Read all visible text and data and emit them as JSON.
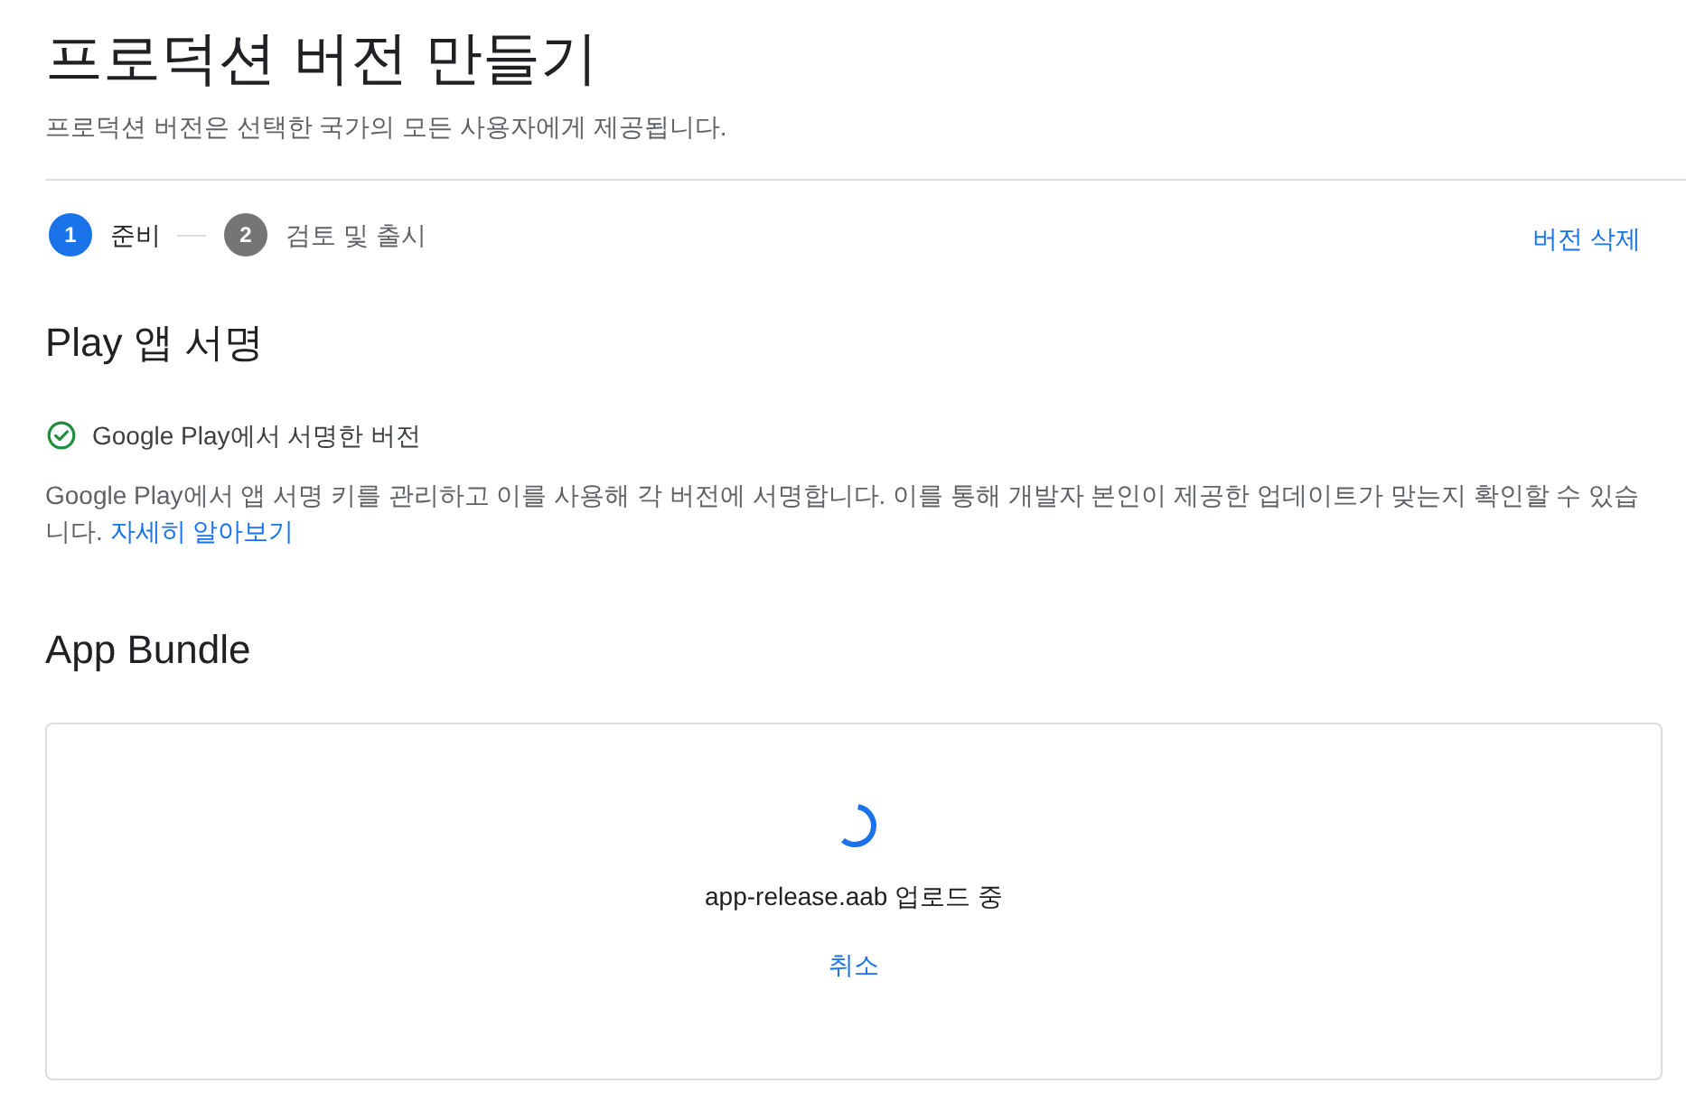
{
  "page": {
    "title": "프로덕션 버전 만들기",
    "subtitle": "프로덕션 버전은 선택한 국가의 모든 사용자에게 제공됩니다."
  },
  "stepper": {
    "steps": [
      {
        "number": "1",
        "label": "준비",
        "selected": true
      },
      {
        "number": "2",
        "label": "검토 및 출시",
        "selected": false
      }
    ],
    "delete_link": "버전 삭제"
  },
  "app_signing": {
    "heading": "Play 앱 서명",
    "status": "Google Play에서 서명한 버전",
    "description": "Google Play에서 앱 서명 키를 관리하고 이를 사용해 각 버전에 서명합니다. 이를 통해 개발자 본인이 제공한 업데이트가 맞는지 확인할 수 있습니다.",
    "learn_more_link": "자세히 알아보기"
  },
  "app_bundle": {
    "heading": "App Bundle",
    "upload": {
      "message": "app-release.aab 업로드 중",
      "cancel": "취소"
    }
  }
}
